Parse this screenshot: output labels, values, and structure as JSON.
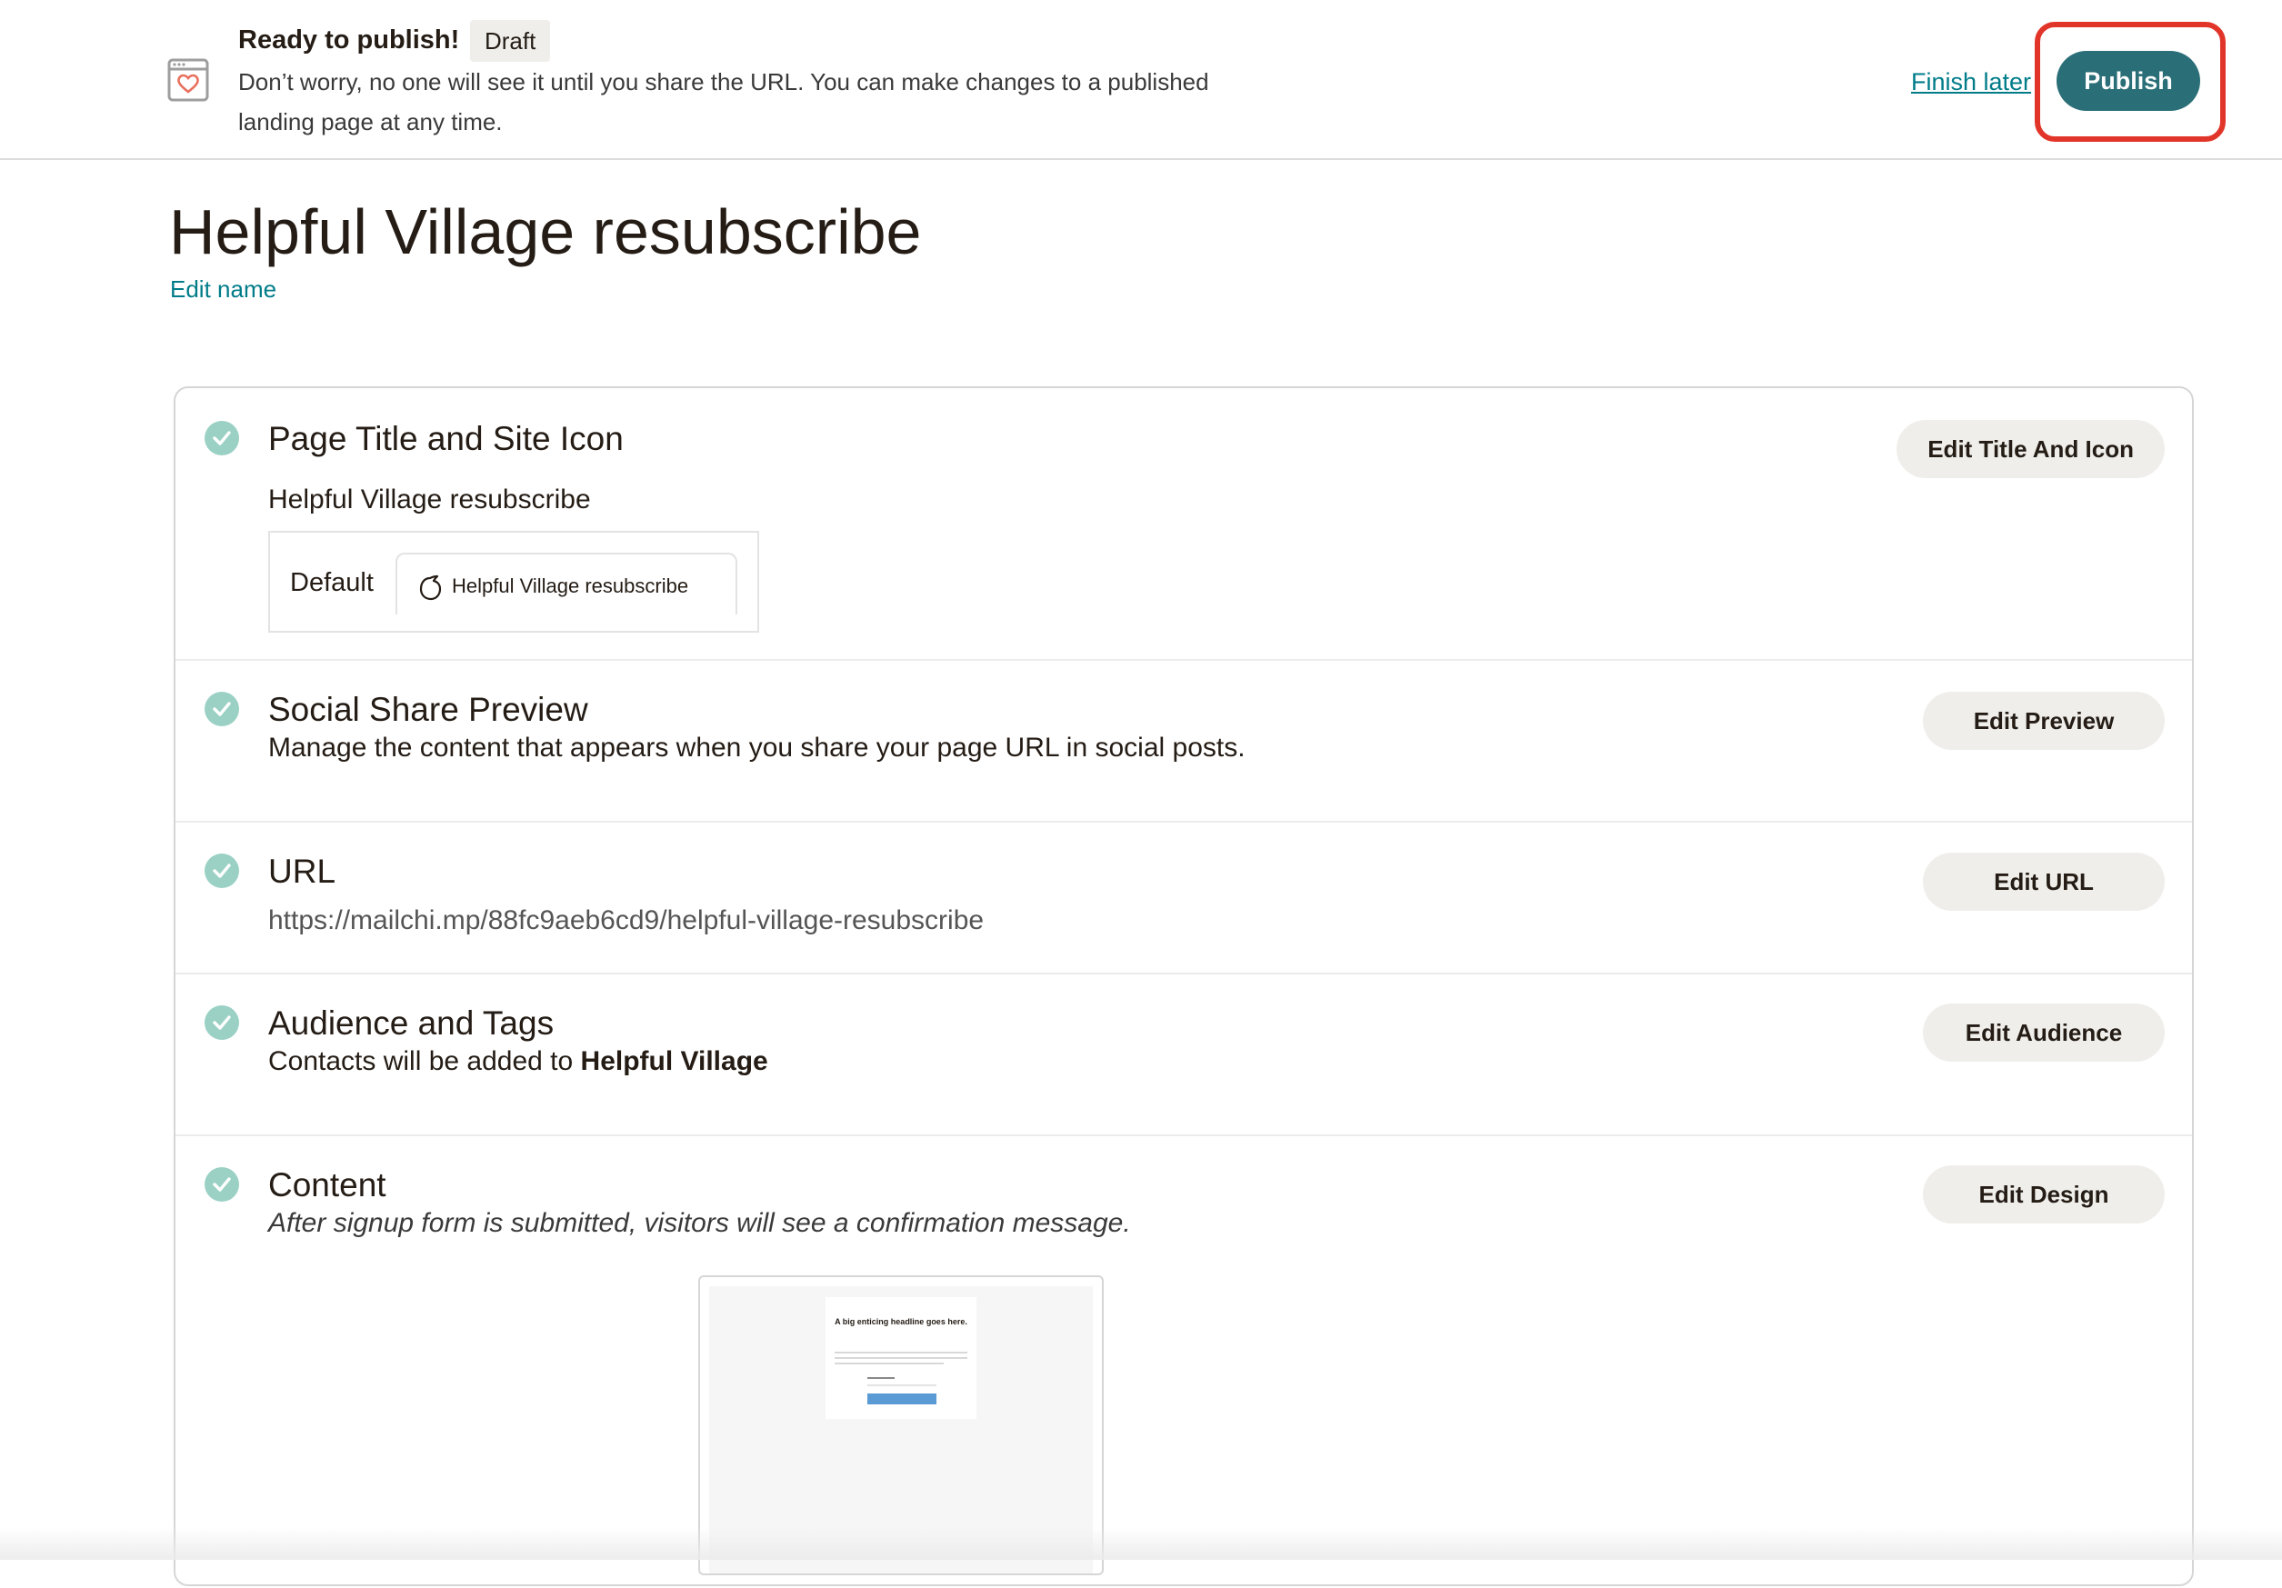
{
  "topbar": {
    "title": "Ready to publish!",
    "badge": "Draft",
    "description": "Don’t worry, no one will see it until you share the URL. You can make changes to a published landing page at any time.",
    "finish_later": "Finish later",
    "publish": "Publish"
  },
  "page": {
    "title": "Helpful Village resubscribe",
    "edit_name": "Edit name"
  },
  "sections": {
    "title_icon": {
      "title": "Page Title and Site Icon",
      "value": "Helpful Village resubscribe",
      "tab_default": "Default",
      "tab_label": "Helpful Village resubscribe",
      "button": "Edit Title And Icon"
    },
    "social": {
      "title": "Social Share Preview",
      "body": "Manage the content that appears when you share your page URL in social posts.",
      "button": "Edit Preview"
    },
    "url": {
      "title": "URL",
      "body": "https://mailchi.mp/88fc9aeb6cd9/helpful-village-resubscribe",
      "button": "Edit URL"
    },
    "audience": {
      "title": "Audience and Tags",
      "body_prefix": "Contacts will be added to ",
      "audience_name": "Helpful Village",
      "button": "Edit Audience"
    },
    "content": {
      "title": "Content",
      "body": "After signup form is submitted, visitors will see a confirmation message.",
      "button": "Edit Design",
      "thumb_headline": "A big enticing headline goes here."
    }
  },
  "colors": {
    "accent": "#007c89",
    "publish_bg": "#2a6f78",
    "highlight": "#e2352a",
    "check": "#9ad1c4"
  }
}
